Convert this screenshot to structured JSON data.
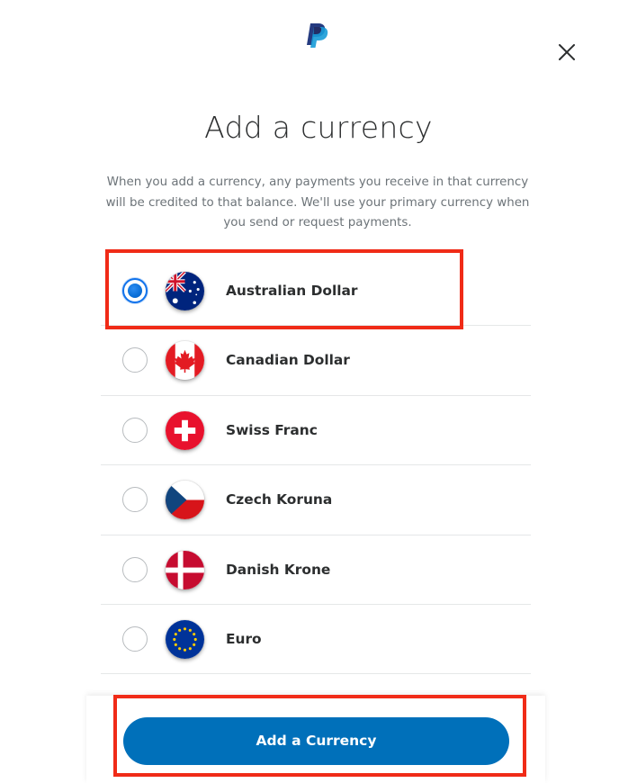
{
  "brand": {
    "logo_icon": "paypal-logo-icon"
  },
  "modal": {
    "title": "Add a currency",
    "description": "When you add a currency, any payments you receive in that currency will be credited to that balance. We'll use your primary currency when you send or request payments.",
    "close_icon": "close-icon"
  },
  "currencies": [
    {
      "name": "Australian Dollar",
      "flag": "australia-flag-icon",
      "selected": true
    },
    {
      "name": "Canadian Dollar",
      "flag": "canada-flag-icon",
      "selected": false
    },
    {
      "name": "Swiss Franc",
      "flag": "switzerland-flag-icon",
      "selected": false
    },
    {
      "name": "Czech Koruna",
      "flag": "czech-flag-icon",
      "selected": false
    },
    {
      "name": "Danish Krone",
      "flag": "denmark-flag-icon",
      "selected": false
    },
    {
      "name": "Euro",
      "flag": "eu-flag-icon",
      "selected": false
    }
  ],
  "footer": {
    "button_label": "Add a Currency"
  },
  "colors": {
    "primary_button": "#0070ba",
    "radio_selected": "#1072eb",
    "highlight_border": "#f02b17",
    "text": "#2c2e2f",
    "muted_text": "#6c7378"
  }
}
